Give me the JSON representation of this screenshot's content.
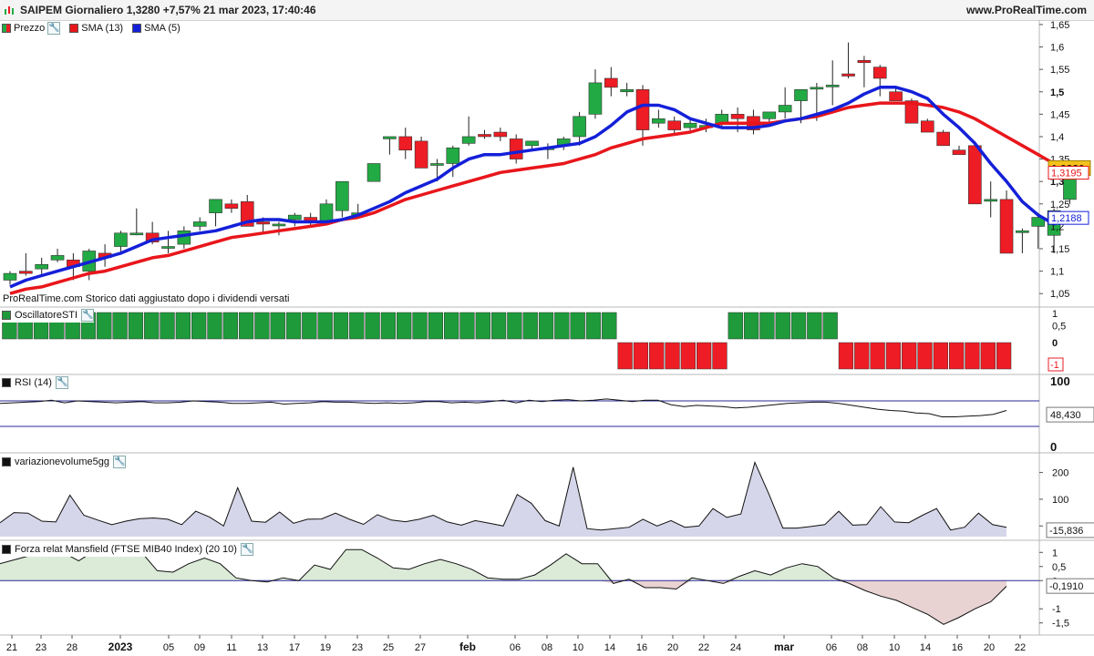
{
  "window": {
    "title": "SAIPEM Giornaliero 1,3280 +7,57% 21 mar 2023, 17:40:46",
    "site": "www.ProRealTime.com"
  },
  "colors": {
    "bull": "#22aa44",
    "bear": "#ee1c24",
    "sma13": "#e8161b",
    "sma5": "#1420d8",
    "osc_bull": "#1e9a3a",
    "osc_bear": "#ee1c24",
    "rsi_line": "#111111",
    "ref_line": "#2a2a9a",
    "volume_fill": "#d6d6ea",
    "mansfield_pos": "#dcebd8",
    "mansfield_neg": "#e8d2d2"
  },
  "price_panel": {
    "legend": {
      "prezzo": "Prezzo",
      "sma13": "SMA (13)",
      "sma5": "SMA (5)"
    },
    "note": "ProRealTime.com Storico dati aggiustato dopo i dividendi versati",
    "y_ticks": [
      "1,65",
      "1,6",
      "1,55",
      "1,5",
      "1,45",
      "1,4",
      "1,35",
      "1,3",
      "1,25",
      "1,2",
      "1,15",
      "1,1",
      "1,05"
    ],
    "last_price": "1,3280",
    "sma13_value": "1,3195",
    "sma5_value": "1,2188"
  },
  "oscillator_panel": {
    "legend": "OscillatoreSTI",
    "y_ticks": [
      "1",
      "0,5",
      "0"
    ],
    "last_value": "-1"
  },
  "rsi_panel": {
    "legend": "RSI (14)",
    "y_ticks": [
      "100",
      "0"
    ],
    "last_value": "48,430"
  },
  "volume_panel": {
    "legend": "variazionevolume5gg",
    "y_ticks": [
      "200",
      "100",
      "0"
    ],
    "last_value": "-15,836"
  },
  "mansfield_panel": {
    "legend": "Forza relat Mansfield (FTSE MIB40 Index) (20 10)",
    "y_ticks": [
      "1",
      "0,5",
      "0",
      "-1",
      "-1,5"
    ],
    "last_value": "-0,1910"
  },
  "x_axis": {
    "labels": [
      "21",
      "23",
      "28",
      "2023",
      "05",
      "09",
      "11",
      "13",
      "17",
      "19",
      "23",
      "25",
      "27",
      "feb",
      "06",
      "08",
      "10",
      "14",
      "16",
      "20",
      "22",
      "24",
      "mar",
      "06",
      "08",
      "10",
      "14",
      "16",
      "20",
      "22"
    ],
    "bold": [
      "2023",
      "feb",
      "mar"
    ]
  },
  "chart_data": [
    {
      "type": "candlestick",
      "name": "Prezzo",
      "ylim": [
        1.02,
        1.66
      ],
      "ohlc": [
        [
          1.08,
          1.1,
          1.07,
          1.095
        ],
        [
          1.1,
          1.14,
          1.09,
          1.095
        ],
        [
          1.105,
          1.13,
          1.09,
          1.115
        ],
        [
          1.125,
          1.15,
          1.12,
          1.135
        ],
        [
          1.125,
          1.14,
          1.08,
          1.11
        ],
        [
          1.1,
          1.15,
          1.08,
          1.145
        ],
        [
          1.14,
          1.16,
          1.11,
          1.13
        ],
        [
          1.155,
          1.19,
          1.14,
          1.185
        ],
        [
          1.185,
          1.24,
          1.18,
          1.185
        ],
        [
          1.185,
          1.21,
          1.16,
          1.165
        ],
        [
          1.155,
          1.19,
          1.14,
          1.155
        ],
        [
          1.16,
          1.2,
          1.15,
          1.19
        ],
        [
          1.2,
          1.22,
          1.19,
          1.21
        ],
        [
          1.23,
          1.26,
          1.2,
          1.26
        ],
        [
          1.25,
          1.26,
          1.23,
          1.24
        ],
        [
          1.255,
          1.27,
          1.2,
          1.2
        ],
        [
          1.21,
          1.22,
          1.185,
          1.205
        ],
        [
          1.205,
          1.21,
          1.18,
          1.205
        ],
        [
          1.215,
          1.23,
          1.2,
          1.225
        ],
        [
          1.22,
          1.23,
          1.2,
          1.21
        ],
        [
          1.21,
          1.26,
          1.21,
          1.25
        ],
        [
          1.235,
          1.3,
          1.22,
          1.3
        ],
        [
          1.225,
          1.25,
          1.22,
          1.23
        ],
        [
          1.3,
          1.34,
          1.3,
          1.34
        ],
        [
          1.395,
          1.4,
          1.36,
          1.4
        ],
        [
          1.4,
          1.42,
          1.35,
          1.37
        ],
        [
          1.39,
          1.4,
          1.34,
          1.33
        ],
        [
          1.34,
          1.35,
          1.3,
          1.34
        ],
        [
          1.34,
          1.38,
          1.31,
          1.375
        ],
        [
          1.385,
          1.445,
          1.38,
          1.4
        ],
        [
          1.405,
          1.415,
          1.395,
          1.4
        ],
        [
          1.41,
          1.42,
          1.39,
          1.4
        ],
        [
          1.395,
          1.405,
          1.34,
          1.35
        ],
        [
          1.38,
          1.39,
          1.37,
          1.39
        ],
        [
          1.375,
          1.385,
          1.35,
          1.375
        ],
        [
          1.38,
          1.4,
          1.37,
          1.395
        ],
        [
          1.4,
          1.455,
          1.38,
          1.445
        ],
        [
          1.45,
          1.55,
          1.44,
          1.52
        ],
        [
          1.53,
          1.555,
          1.49,
          1.51
        ],
        [
          1.5,
          1.52,
          1.49,
          1.505
        ],
        [
          1.505,
          1.515,
          1.38,
          1.415
        ],
        [
          1.43,
          1.46,
          1.42,
          1.44
        ],
        [
          1.435,
          1.445,
          1.405,
          1.415
        ],
        [
          1.42,
          1.44,
          1.41,
          1.43
        ],
        [
          1.42,
          1.44,
          1.41,
          1.425
        ],
        [
          1.43,
          1.46,
          1.42,
          1.45
        ],
        [
          1.45,
          1.465,
          1.41,
          1.44
        ],
        [
          1.445,
          1.46,
          1.405,
          1.415
        ],
        [
          1.44,
          1.45,
          1.425,
          1.455
        ],
        [
          1.455,
          1.51,
          1.44,
          1.47
        ],
        [
          1.48,
          1.5,
          1.43,
          1.505
        ],
        [
          1.51,
          1.52,
          1.435,
          1.51
        ],
        [
          1.515,
          1.57,
          1.47,
          1.515
        ],
        [
          1.54,
          1.61,
          1.53,
          1.535
        ],
        [
          1.57,
          1.58,
          1.51,
          1.565
        ],
        [
          1.555,
          1.56,
          1.49,
          1.53
        ],
        [
          1.5,
          1.51,
          1.48,
          1.48
        ],
        [
          1.48,
          1.485,
          1.43,
          1.43
        ],
        [
          1.435,
          1.44,
          1.41,
          1.41
        ],
        [
          1.41,
          1.415,
          1.38,
          1.38
        ],
        [
          1.37,
          1.38,
          1.36,
          1.36
        ],
        [
          1.38,
          1.39,
          1.25,
          1.25
        ],
        [
          1.26,
          1.3,
          1.22,
          1.26
        ],
        [
          1.26,
          1.28,
          1.14,
          1.14
        ],
        [
          1.19,
          1.195,
          1.14,
          1.19
        ],
        [
          1.2,
          1.23,
          1.15,
          1.22
        ],
        [
          1.18,
          1.24,
          1.14,
          1.235
        ],
        [
          1.26,
          1.29,
          1.25,
          1.328
        ]
      ]
    },
    {
      "type": "line",
      "name": "SMA (13)",
      "values": [
        1.05,
        1.06,
        1.065,
        1.075,
        1.085,
        1.095,
        1.1,
        1.11,
        1.12,
        1.13,
        1.135,
        1.145,
        1.155,
        1.165,
        1.175,
        1.18,
        1.185,
        1.19,
        1.195,
        1.2,
        1.205,
        1.215,
        1.22,
        1.23,
        1.245,
        1.26,
        1.27,
        1.28,
        1.29,
        1.3,
        1.31,
        1.32,
        1.325,
        1.33,
        1.335,
        1.34,
        1.35,
        1.36,
        1.375,
        1.385,
        1.395,
        1.4,
        1.405,
        1.41,
        1.42,
        1.43,
        1.43,
        1.43,
        1.43,
        1.435,
        1.44,
        1.445,
        1.455,
        1.465,
        1.47,
        1.475,
        1.475,
        1.475,
        1.47,
        1.465,
        1.455,
        1.44,
        1.42,
        1.4,
        1.38,
        1.36,
        1.34,
        1.3195
      ]
    },
    {
      "type": "line",
      "name": "SMA (5)",
      "values": [
        1.065,
        1.08,
        1.09,
        1.1,
        1.11,
        1.12,
        1.13,
        1.14,
        1.155,
        1.17,
        1.175,
        1.18,
        1.185,
        1.19,
        1.2,
        1.21,
        1.215,
        1.215,
        1.21,
        1.21,
        1.21,
        1.215,
        1.225,
        1.24,
        1.255,
        1.275,
        1.29,
        1.305,
        1.33,
        1.35,
        1.36,
        1.36,
        1.365,
        1.37,
        1.375,
        1.38,
        1.385,
        1.4,
        1.425,
        1.455,
        1.47,
        1.47,
        1.46,
        1.44,
        1.43,
        1.42,
        1.42,
        1.42,
        1.425,
        1.435,
        1.44,
        1.45,
        1.46,
        1.475,
        1.495,
        1.51,
        1.51,
        1.5,
        1.485,
        1.45,
        1.42,
        1.385,
        1.34,
        1.3,
        1.255,
        1.225,
        1.205,
        1.2188
      ]
    },
    {
      "type": "bar",
      "name": "OscillatoreSTI",
      "values": [
        1,
        1,
        1,
        1,
        1,
        1,
        1,
        1,
        1,
        1,
        1,
        1,
        1,
        1,
        1,
        1,
        1,
        1,
        1,
        1,
        1,
        1,
        1,
        1,
        1,
        1,
        1,
        1,
        1,
        1,
        1,
        1,
        1,
        1,
        1,
        1,
        1,
        1,
        1,
        -1,
        -1,
        -1,
        -1,
        -1,
        -1,
        -1,
        1,
        1,
        1,
        1,
        1,
        1,
        1,
        -1,
        -1,
        -1,
        -1,
        -1,
        -1,
        -1,
        -1,
        -1,
        -1,
        -1
      ],
      "ylim": [
        -1,
        1
      ]
    },
    {
      "type": "line",
      "name": "RSI (14)",
      "ylim": [
        0,
        100
      ],
      "reference_lines": [
        70,
        30
      ],
      "values": [
        66,
        67,
        68,
        69,
        71,
        67,
        70,
        69,
        68,
        67,
        68,
        69,
        67,
        67,
        68,
        70,
        69,
        68,
        66,
        66,
        67,
        68,
        65,
        66,
        67,
        69,
        68,
        68,
        67,
        66,
        67,
        66,
        67,
        69,
        69,
        67,
        68,
        67,
        69,
        71,
        67,
        71,
        69,
        71,
        72,
        70,
        71,
        73,
        71,
        69,
        71,
        71,
        64,
        61,
        63,
        62,
        61,
        59,
        60,
        62,
        64,
        66,
        67,
        68,
        68,
        66,
        63,
        60,
        57,
        55,
        54,
        51,
        50,
        45,
        45,
        46,
        47,
        49,
        55
      ]
    },
    {
      "type": "area",
      "name": "variazionevolume5gg",
      "ylim": [
        -40,
        260
      ],
      "values": [
        12,
        50,
        48,
        18,
        15,
        115,
        40,
        22,
        5,
        18,
        27,
        30,
        25,
        5,
        55,
        33,
        0,
        143,
        18,
        14,
        52,
        10,
        25,
        26,
        48,
        25,
        6,
        42,
        22,
        16,
        25,
        40,
        15,
        3,
        20,
        10,
        0,
        118,
        85,
        20,
        0,
        220,
        -10,
        -15,
        -10,
        -5,
        25,
        0,
        20,
        -5,
        0,
        65,
        32,
        45,
        238,
        120,
        -8,
        -8,
        -2,
        5,
        55,
        3,
        5,
        72,
        15,
        12,
        40,
        65,
        -15,
        -5,
        48,
        5,
        -5
      ]
    },
    {
      "type": "area",
      "name": "Forza relat Mansfield (FTSE MIB40 Index) (20 10)",
      "ylim": [
        -1.8,
        1.3
      ],
      "values": [
        0.6,
        0.75,
        0.9,
        1.0,
        1.0,
        0.7,
        1.05,
        0.95,
        1.0,
        1.0,
        0.35,
        0.3,
        0.6,
        0.8,
        0.6,
        0.1,
        0.0,
        -0.05,
        0.1,
        0.0,
        0.55,
        0.4,
        1.1,
        1.1,
        0.8,
        0.45,
        0.4,
        0.6,
        0.75,
        0.6,
        0.4,
        0.1,
        0.05,
        0.05,
        0.2,
        0.55,
        0.95,
        0.6,
        0.6,
        -0.1,
        0.05,
        -0.25,
        -0.25,
        -0.3,
        0.1,
        0.0,
        -0.1,
        0.15,
        0.35,
        0.2,
        0.45,
        0.6,
        0.5,
        0.1,
        -0.1,
        -0.35,
        -0.55,
        -0.7,
        -0.95,
        -1.2,
        -1.55,
        -1.3,
        -1.0,
        -0.75,
        -0.2
      ]
    }
  ]
}
